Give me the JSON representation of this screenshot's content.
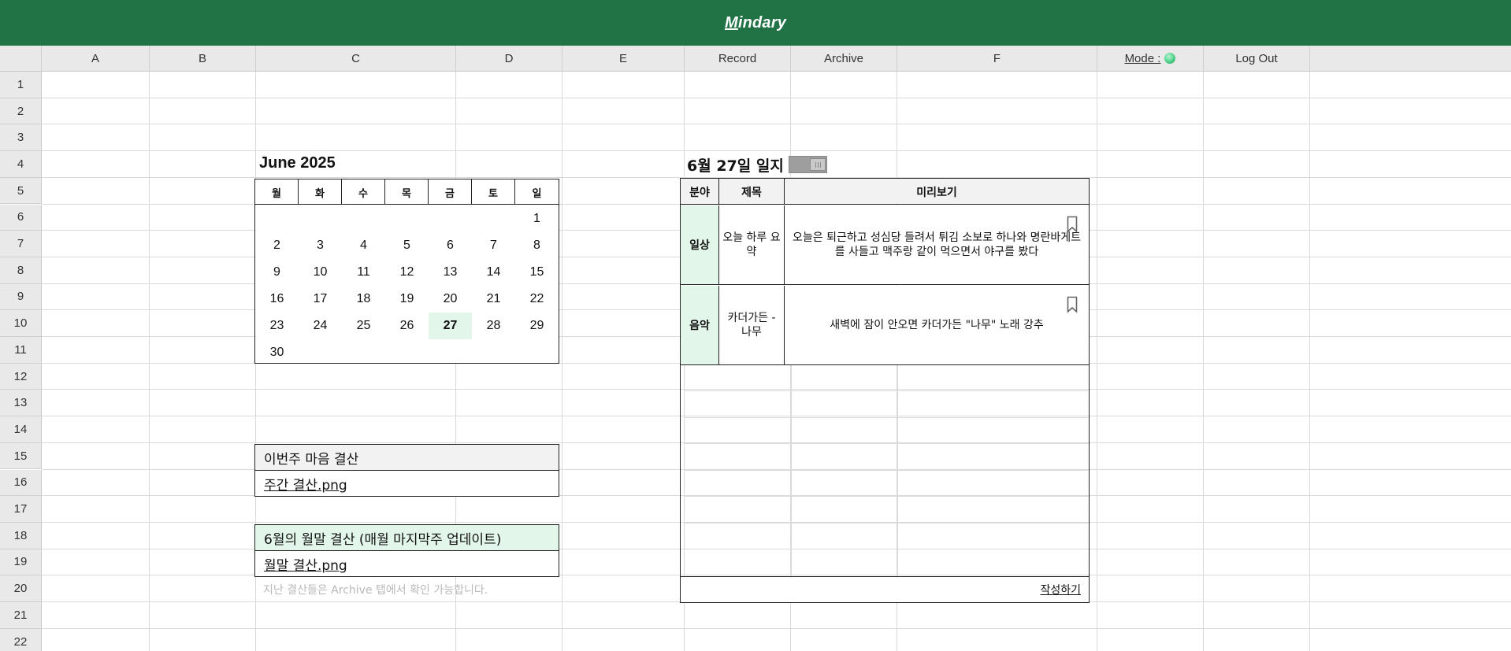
{
  "app": {
    "brand_m": "M",
    "brand_rest": "indary"
  },
  "columns": [
    "A",
    "B",
    "C",
    "D",
    "E"
  ],
  "nav": {
    "record": "Record",
    "archive": "Archive",
    "col_f": "F",
    "mode_label": "Mode :",
    "logout": "Log Out"
  },
  "rows": [
    "1",
    "2",
    "3",
    "4",
    "5",
    "6",
    "7",
    "8",
    "9",
    "10",
    "11",
    "12",
    "13",
    "14",
    "15",
    "16",
    "17",
    "18",
    "19",
    "20",
    "21",
    "22"
  ],
  "calendar": {
    "title": "June 2025",
    "weekdays": [
      "월",
      "화",
      "수",
      "목",
      "금",
      "토",
      "일"
    ],
    "weeks": [
      [
        "",
        "",
        "",
        "",
        "",
        "",
        "1"
      ],
      [
        "2",
        "3",
        "4",
        "5",
        "6",
        "7",
        "8"
      ],
      [
        "9",
        "10",
        "11",
        "12",
        "13",
        "14",
        "15"
      ],
      [
        "16",
        "17",
        "18",
        "19",
        "20",
        "21",
        "22"
      ],
      [
        "23",
        "24",
        "25",
        "26",
        "27",
        "28",
        "29"
      ],
      [
        "30",
        "",
        "",
        "",
        "",
        "",
        ""
      ]
    ],
    "today": "27"
  },
  "weekly": {
    "title": "이번주 마음 결산",
    "file": "주간 결산.png"
  },
  "monthly": {
    "title": "6월의 월말 결산 (매월 마지막주 업데이트)",
    "file": "월말 결산.png"
  },
  "archive_note": "지난 결산들은 Archive 탭에서 확인 가능합니다.",
  "journal": {
    "title": "6월 27일 일지",
    "headers": {
      "category": "분야",
      "title": "제목",
      "preview": "미리보기"
    },
    "entries": [
      {
        "category": "일상",
        "title": "오늘 하루 요약",
        "preview": "오늘은 퇴근하고 성심당 들려서 튀김 소보로 하나와 명란바게트를 사들고 맥주랑 같이 먹으면서 야구를 봤다"
      },
      {
        "category": "음악",
        "title": "카더가든 - 나무",
        "preview": "새벽에 잠이 안오면 카더가든 \"나무\" 노래 강추"
      }
    ],
    "write_link": "작성하기"
  },
  "colors": {
    "header_green": "#217346",
    "highlight_green": "#e3f6ea",
    "mode_dot": "#4fd08a"
  },
  "icons": {
    "bookmark": "bookmark-icon",
    "mode": "mode-dot-icon",
    "toggle": "toggle-switch-icon"
  }
}
